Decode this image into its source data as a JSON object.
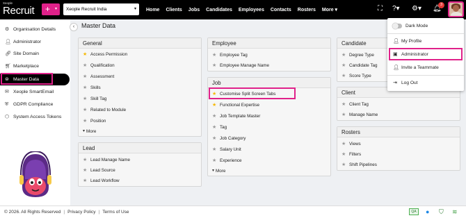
{
  "app": {
    "brand_small": "Xeople",
    "brand_main": "Recruit",
    "plus_label": "+",
    "company": "Xeople Recruit India"
  },
  "nav": [
    "Home",
    "Clients",
    "Jobs",
    "Candidates",
    "Employees",
    "Contacts",
    "Rosters",
    "More ▾"
  ],
  "notifications_count": "3",
  "sidebar": {
    "items": [
      {
        "label": "Organisation Details",
        "icon": "gear-icon"
      },
      {
        "label": "Administrator",
        "icon": "user-icon"
      },
      {
        "label": "Site Domain",
        "icon": "link-icon"
      },
      {
        "label": "Marketplace",
        "icon": "cart-icon"
      },
      {
        "label": "Master Data",
        "icon": "database-icon",
        "active": true
      },
      {
        "label": "Xeople SmartEmail",
        "icon": "email-icon"
      },
      {
        "label": "GDPR Compliance",
        "icon": "shield-icon"
      },
      {
        "label": "System Access Tokens",
        "icon": "token-icon"
      }
    ]
  },
  "page_title": "Master Data",
  "panels": {
    "general": {
      "title": "General",
      "items": [
        "Access Permission",
        "Qualification",
        "Assessment",
        "Skills",
        "Skill Tag",
        "Related to Module",
        "Position"
      ],
      "more": "More"
    },
    "lead": {
      "title": "Lead",
      "items": [
        "Lead Manage Name",
        "Lead Source",
        "Lead Workflow"
      ]
    },
    "employee": {
      "title": "Employee",
      "items": [
        "Employee Tag",
        "Employee Manage Name"
      ]
    },
    "job": {
      "title": "Job",
      "items": [
        "Customise Split Screen Tabs",
        "Functional Expertise",
        "Job Template Master",
        "Tag",
        "Job Category",
        "Salary Unit",
        "Experience"
      ],
      "more": "More"
    },
    "candidate": {
      "title": "Candidate",
      "items": [
        "Degree Type",
        "Candidate Tag",
        "Score Type"
      ]
    },
    "client": {
      "title": "Client",
      "items": [
        "Client Tag",
        "Manage Name"
      ]
    },
    "rosters": {
      "title": "Rosters",
      "items": [
        "Views",
        "Filters",
        "Shift Pipelines"
      ]
    }
  },
  "dropdown": {
    "dark_mode": "Dark Mode",
    "my_profile": "My Profile",
    "administrator": "Administrator",
    "invite": "Invite a Teammate",
    "logout": "Log Out"
  },
  "footer": {
    "copyright": "© 2026. All Rights Reserved",
    "privacy": "Privacy Policy",
    "terms": "Terms of Use",
    "env_badge": "QA"
  },
  "colors": {
    "accent": "#e0218a",
    "star_active": "#f5b800",
    "topbar": "#000000"
  }
}
